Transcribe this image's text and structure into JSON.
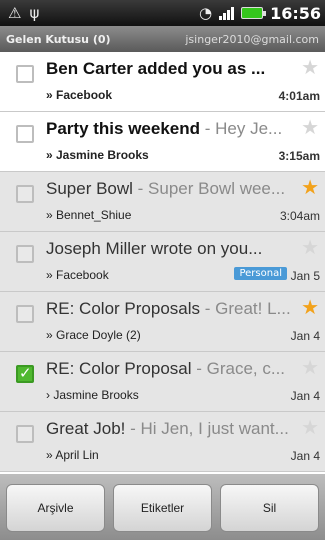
{
  "status_bar": {
    "time": "16:56",
    "icons": [
      "usb-debug-icon",
      "usb-icon",
      "wifi-icon",
      "signal-icon",
      "battery-icon"
    ],
    "battery_color": "#35c61c"
  },
  "account": {
    "inbox_label": "Gelen Kutusu (0)",
    "email": "jsinger2010@gmail.com"
  },
  "messages": [
    {
      "subject": "Ben Carter added you as ...",
      "snippet": "",
      "sender": "» Facebook",
      "time": "4:01am",
      "starred": false,
      "checked": false,
      "read": false,
      "label": ""
    },
    {
      "subject": "Party this weekend",
      "snippet": " - Hey Je...",
      "sender": "» Jasmine Brooks",
      "time": "3:15am",
      "starred": false,
      "checked": false,
      "read": false,
      "label": ""
    },
    {
      "subject": "Super Bowl",
      "snippet": " - Super Bowl wee...",
      "sender": "» Bennet_Shiue",
      "time": "3:04am",
      "starred": true,
      "checked": false,
      "read": true,
      "label": ""
    },
    {
      "subject": "Joseph Miller wrote on you...",
      "snippet": "",
      "sender": "» Facebook",
      "time": "Jan 5",
      "starred": false,
      "checked": false,
      "read": true,
      "label": "Personal"
    },
    {
      "subject": "RE: Color Proposals",
      "snippet": " - Great! L...",
      "sender": "» Grace Doyle (2)",
      "time": "Jan 4",
      "starred": true,
      "checked": false,
      "read": true,
      "label": ""
    },
    {
      "subject": "RE: Color Proposal",
      "snippet": " - Grace, c...",
      "sender": "› Jasmine Brooks",
      "time": "Jan 4",
      "starred": false,
      "checked": true,
      "read": true,
      "label": ""
    },
    {
      "subject": "Great Job!",
      "snippet": " - Hi Jen, I just want...",
      "sender": "» April Lin",
      "time": "Jan 4",
      "starred": false,
      "checked": false,
      "read": true,
      "label": ""
    }
  ],
  "actions": {
    "archive": "Arşivle",
    "labels": "Etiketler",
    "delete": "Sil"
  },
  "colors": {
    "star_on": "#f2a21b",
    "checkbox_on": "#4fb82f",
    "label_bg": "#4a9ad7"
  }
}
